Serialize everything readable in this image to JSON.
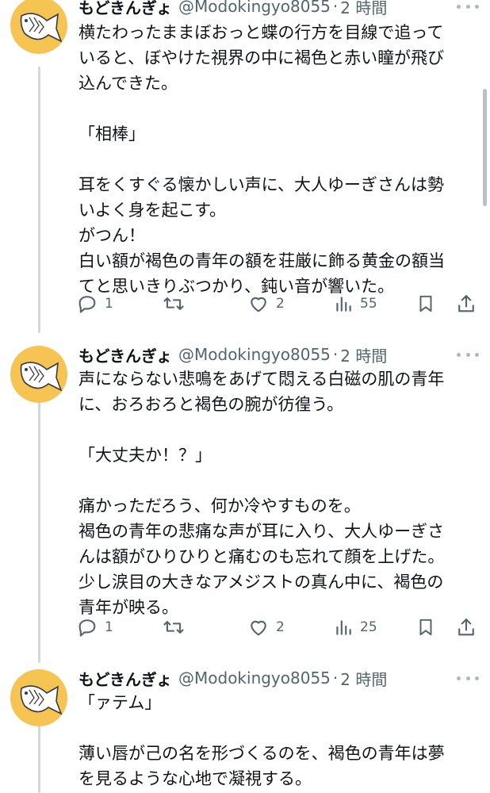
{
  "tweets": [
    {
      "name": "もどきんぎょ",
      "handle": "@Modokingyo8055",
      "sep": "·",
      "time": "2 時間",
      "lines": [
        "横たわったままぼおっと蝶の行方を目線で追って",
        "いると、ぼやけた視界の中に褐色と赤い瞳が飛び",
        "込んできた。",
        "",
        "「相棒」",
        "",
        "耳をくすぐる懐かしい声に、大人ゆーぎさんは勢",
        "いよく身を起こす。",
        "がつん！",
        "白い額が褐色の青年の額を荘厳に飾る黄金の額当",
        "てと思いきりぶつかり、鈍い音が響いた。"
      ],
      "replies": "1",
      "retweets": "",
      "likes": "2",
      "views": "55"
    },
    {
      "name": "もどきんぎょ",
      "handle": "@Modokingyo8055",
      "sep": "·",
      "time": "2 時間",
      "lines": [
        "声にならない悲鳴をあげて悶える白磁の肌の青年",
        "に、おろおろと褐色の腕が彷徨う。",
        "",
        "「大丈夫か！？」",
        "",
        "痛かっただろう、何か冷やすものを。",
        "褐色の青年の悲痛な声が耳に入り、大人ゆーぎさ",
        "んは額がひりひりと痛むのも忘れて顔を上げた。",
        "少し涙目の大きなアメジストの真ん中に、褐色の",
        "青年が映る。"
      ],
      "replies": "1",
      "retweets": "",
      "likes": "2",
      "views": "25"
    },
    {
      "name": "もどきんぎょ",
      "handle": "@Modokingyo8055",
      "sep": "·",
      "time": "2 時間",
      "lines": [
        "「ァテム」",
        "",
        "薄い唇が己の名を形づくるのを、褐色の青年は夢",
        "を見るような心地で凝視する。"
      ]
    }
  ],
  "icons": {
    "avatar": "fish-icon",
    "reply": "reply-icon",
    "retweet": "retweet-icon",
    "like": "heart-icon",
    "views": "views-icon",
    "bookmark": "bookmark-icon",
    "share": "share-icon",
    "more": "more-icon"
  },
  "colors": {
    "avatar_bg": "#f6c453",
    "thread_line": "#cfd9de",
    "muted": "#536471"
  }
}
